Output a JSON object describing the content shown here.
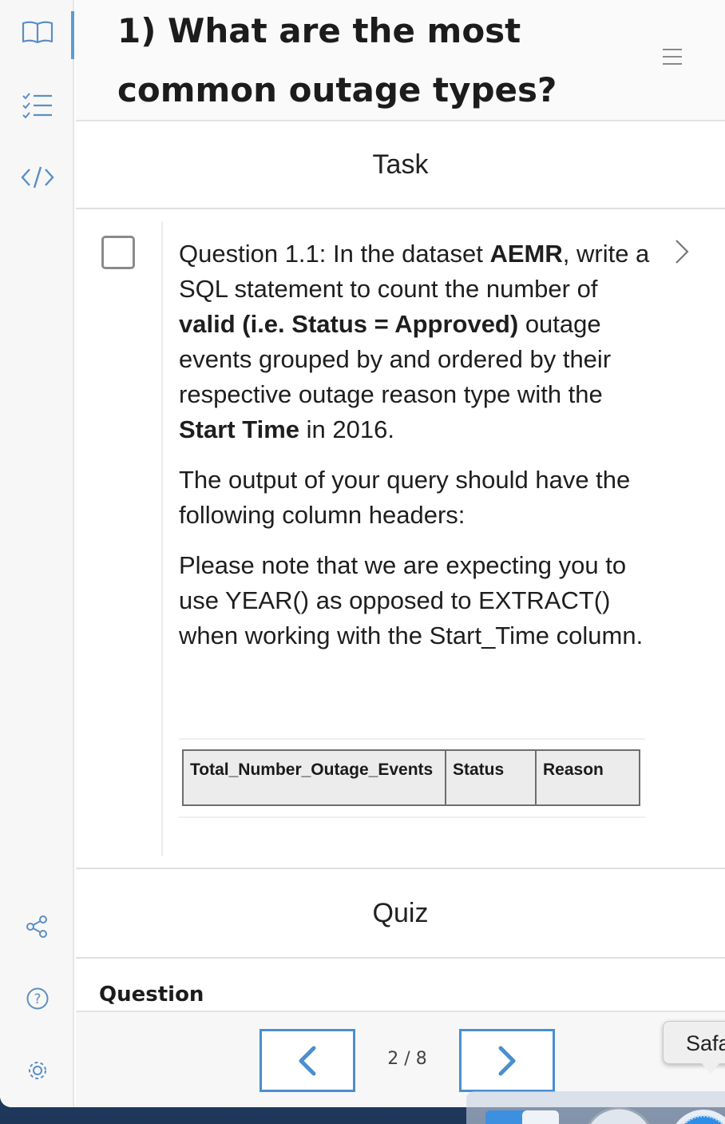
{
  "header": {
    "title": "1) What are the most common outage types?",
    "menu_icon": "hamburger-icon"
  },
  "rail": {
    "top_items": [
      {
        "name": "book-icon",
        "active": true
      },
      {
        "name": "checklist-icon",
        "active": false
      },
      {
        "name": "code-icon",
        "active": false
      }
    ],
    "bottom_items": [
      {
        "name": "share-icon"
      },
      {
        "name": "help-icon"
      },
      {
        "name": "settings-icon"
      }
    ]
  },
  "task": {
    "heading": "Task",
    "checked": false,
    "p1": {
      "t1": "Question 1.1: In the dataset ",
      "b1": "AEMR",
      "t2": ", write a SQL statement to count the number of ",
      "b2": "valid (i.e. Status = Approved)",
      "t3": " outage events grouped by and ordered by their respective outage reason type with the ",
      "b3": "Start Time",
      "t4": " in 2016."
    },
    "p2": "The output of your query should have the following column headers:",
    "p3": "Please note that we are expecting you to use YEAR() as opposed to EXTRACT() when working with the Start_Time column.",
    "columns": [
      "Total_Number_Outage_Events",
      "Status",
      "Reason"
    ]
  },
  "quiz": {
    "heading": "Quiz",
    "question_label": "Question"
  },
  "pager": {
    "current": 2,
    "total": 8,
    "label": "2 / 8"
  },
  "tooltip": {
    "text": "Safari"
  },
  "colors": {
    "accent": "#4a8fce",
    "rail_active": "#5b9bd5",
    "icon": "#5b8fc4"
  }
}
